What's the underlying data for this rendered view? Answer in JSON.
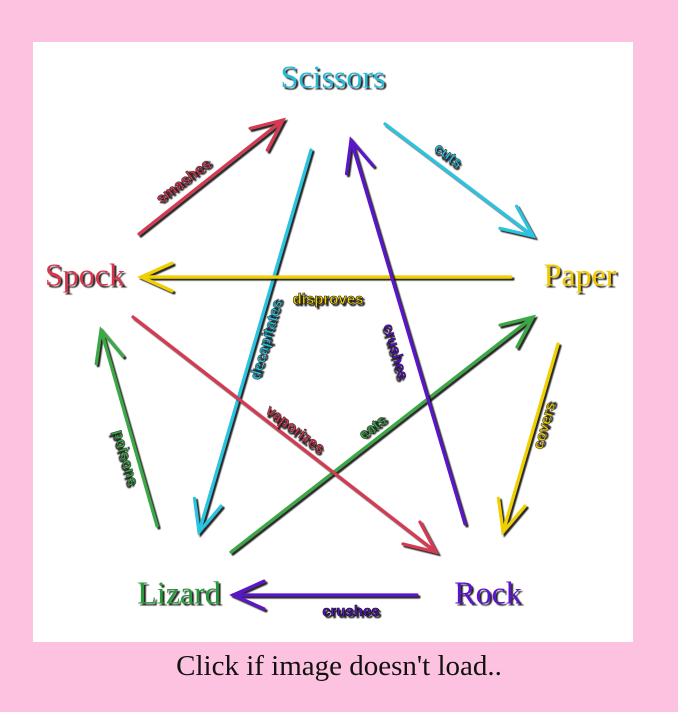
{
  "diagram": {
    "nodes": [
      {
        "id": "scissors",
        "label": "Scissors",
        "color": "#29b8d8"
      },
      {
        "id": "paper",
        "label": "Paper",
        "color": "#f0c800"
      },
      {
        "id": "rock",
        "label": "Rock",
        "color": "#5a12c8"
      },
      {
        "id": "lizard",
        "label": "Lizard",
        "color": "#2a9b3c"
      },
      {
        "id": "spock",
        "label": "Spock",
        "color": "#d8364e"
      }
    ],
    "edges": [
      {
        "id": "scissors-cuts-paper",
        "from": "scissors",
        "to": "paper",
        "label": "cuts",
        "color": "#29c3e0"
      },
      {
        "id": "paper-covers-rock",
        "from": "paper",
        "to": "rock",
        "label": "covers",
        "color": "#f0d000"
      },
      {
        "id": "rock-crushes-lizard",
        "from": "rock",
        "to": "lizard",
        "label": "crushes",
        "color": "#5a12c8"
      },
      {
        "id": "lizard-poisons-spock",
        "from": "lizard",
        "to": "spock",
        "label": "poisons",
        "color": "#3aa845"
      },
      {
        "id": "spock-smashes-scissors",
        "from": "spock",
        "to": "scissors",
        "label": "smashes",
        "color": "#d43a52"
      },
      {
        "id": "scissors-decapitates-lizard",
        "from": "scissors",
        "to": "lizard",
        "label": "decapitates",
        "color": "#29c3e0"
      },
      {
        "id": "lizard-eats-paper",
        "from": "lizard",
        "to": "paper",
        "label": "eats",
        "color": "#3aa845"
      },
      {
        "id": "paper-disproves-spock",
        "from": "paper",
        "to": "spock",
        "label": "disproves",
        "color": "#f0d000"
      },
      {
        "id": "spock-vaporizes-rock",
        "from": "spock",
        "to": "rock",
        "label": "vaporizes",
        "color": "#d43a52"
      },
      {
        "id": "rock-crushes-scissors",
        "from": "rock",
        "to": "scissors",
        "label": "crushes",
        "color": "#5a12c8"
      }
    ]
  },
  "caption": "Click if image doesn't load.."
}
